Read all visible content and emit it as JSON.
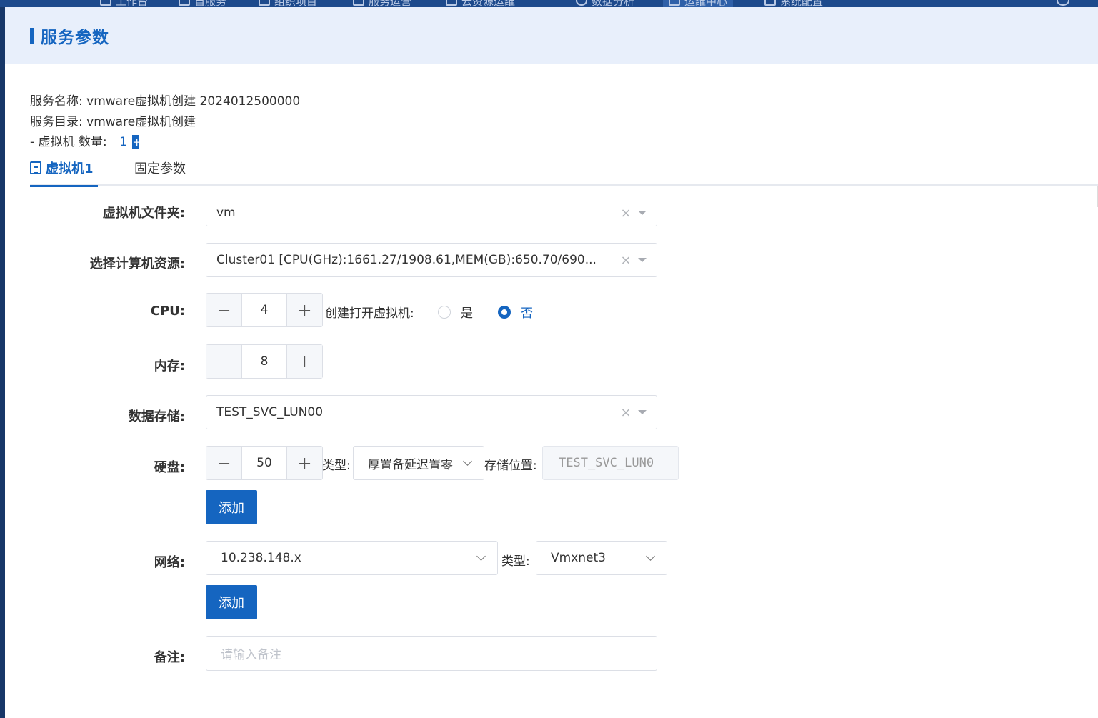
{
  "nav": {
    "items": [
      "工作台",
      "自服务",
      "组织项目",
      "服务运营",
      "云资源运维",
      "数据分析",
      "运维中心",
      "系统配置"
    ],
    "active_index": 6
  },
  "panel": {
    "title": "服务参数"
  },
  "info": {
    "service_name_label": "服务名称:",
    "service_name": "vmware虚拟机创建 2024012500000",
    "service_catalog_label": "服务目录:",
    "service_catalog": "vmware虚拟机创建",
    "vm_count_label": "- 虚拟机 数量:",
    "vm_count": "1",
    "vm_count_plus": "+"
  },
  "tabs": [
    {
      "label": "虚拟机1",
      "active": true
    },
    {
      "label": "固定参数",
      "active": false
    }
  ],
  "form": {
    "folder": {
      "label": "虚拟机文件夹:",
      "value": "vm"
    },
    "compute": {
      "label": "选择计算机资源:",
      "value": "Cluster01 [CPU(GHz):1661.27/1908.61,MEM(GB):650.70/690..."
    },
    "cpu": {
      "label": "CPU:",
      "value": "4",
      "minus": "−",
      "plus": "+"
    },
    "power_on": {
      "label": "创建打开虚拟机:",
      "options": [
        "是",
        "否"
      ],
      "selected": "否"
    },
    "memory": {
      "label": "内存:",
      "value": "8",
      "minus": "−",
      "plus": "+"
    },
    "datastore": {
      "label": "数据存储:",
      "value": "TEST_SVC_LUN00"
    },
    "disk": {
      "label": "硬盘:",
      "value": "50",
      "minus": "−",
      "plus": "+",
      "type_label": "类型:",
      "type_value": "厚置备延迟置零",
      "location_label": "存储位置:",
      "location_value": "TEST_SVC_LUN0",
      "add_label": "添加"
    },
    "network": {
      "label": "网络:",
      "value": "10.238.148.x",
      "type_label": "类型:",
      "type_value": "Vmxnet3",
      "add_label": "添加"
    },
    "remark": {
      "label": "备注:",
      "placeholder": "请输入备注"
    }
  }
}
